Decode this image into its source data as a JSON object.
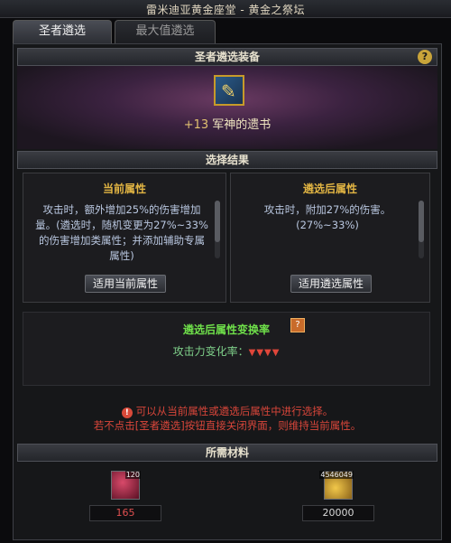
{
  "location": "雷米迪亚黄金座堂 - 黄金之祭坛",
  "tabs": [
    {
      "label": "圣者遴选",
      "active": true
    },
    {
      "label": "最大值遴选",
      "active": false
    }
  ],
  "equipment_section": {
    "title": "圣者遴选装备",
    "help": "?",
    "item": {
      "enhance": "+13",
      "name": "军神的遗书",
      "icon": "scroll-icon"
    }
  },
  "result_section": {
    "title": "选择结果",
    "current": {
      "title": "当前属性",
      "desc": "攻击时，额外增加25%的伤害增加量。(遴选时，随机变更为27%~33%的伤害增加类属性；并添加辅助专属属性)",
      "button": "适用当前属性"
    },
    "after": {
      "title": "遴选后属性",
      "desc": "攻击时，附加27%的伤害。(27%~33%)",
      "button": "适用遴选属性"
    }
  },
  "rate": {
    "title": "遴选后属性变换率",
    "label": "攻击力变化率：",
    "arrows": "▼▼▼▼"
  },
  "warnings": {
    "line1": "可以从当前属性或遴选后属性中进行选择。",
    "line2": "若不点击[圣者遴选]按钮直接关闭界面，则维持当前属性。"
  },
  "materials": {
    "title": "所需材料",
    "items": [
      {
        "icon": "red-orb-icon",
        "owned": "120",
        "required": "165",
        "value_color": "#e05050"
      },
      {
        "icon": "gold-coin-icon",
        "owned": "4546049",
        "required": "20000",
        "value_color": "#d8d8d8"
      }
    ]
  }
}
